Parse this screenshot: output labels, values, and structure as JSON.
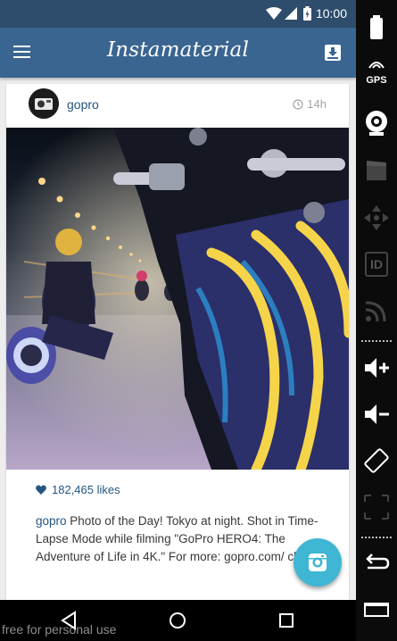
{
  "status_bar": {
    "time": "10:00"
  },
  "app_bar": {
    "title": "Instamaterial"
  },
  "post": {
    "username": "gopro",
    "time_ago": "14h",
    "likes": "182,465 likes",
    "caption_user": "gopro",
    "caption_text": " Photo of the Day! Tokyo at night. Shot in Time-Lapse Mode while filming \"GoPro HERO4: The Adventure of Life in 4K.\" For more: gopro.com/ channel"
  },
  "emulator_panel": {
    "gps_label": "GPS",
    "id_label": "ID"
  },
  "watermark": "free for personal use",
  "colors": {
    "status_bar": "#2e4c6b",
    "app_bar": "#3a6591",
    "link": "#24557e",
    "fab": "#3fb6d3"
  },
  "icons": [
    "wifi-icon",
    "signal-icon",
    "battery-icon",
    "menu-icon",
    "inbox-icon",
    "clock-icon",
    "heart-icon",
    "camera-icon",
    "back-icon",
    "home-icon",
    "recents-icon"
  ]
}
